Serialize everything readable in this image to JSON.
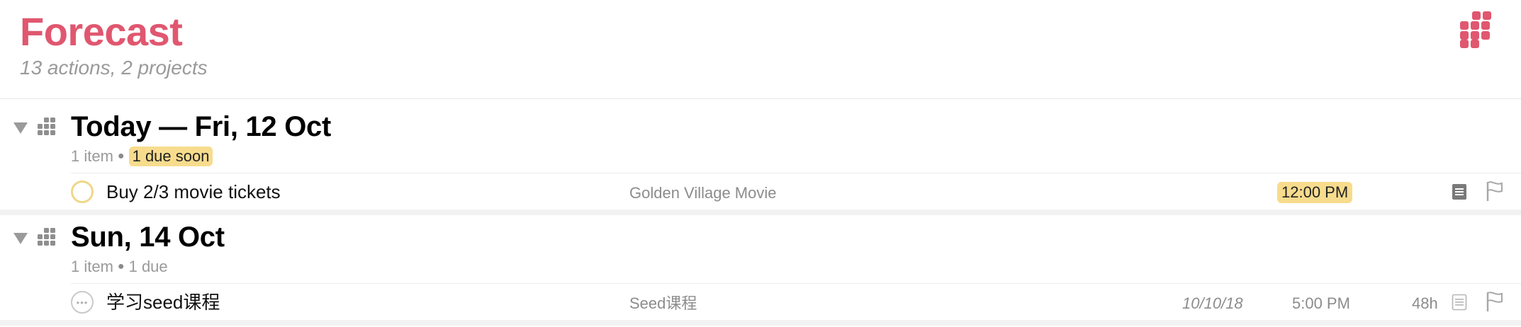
{
  "header": {
    "title": "Forecast",
    "subtitle": "13 actions, 2 projects",
    "accent_color": "#e0576f",
    "icon": "forecast-grid-icon"
  },
  "sections": [
    {
      "title": "Today — Fri, 12 Oct",
      "meta_count": "1 item",
      "meta_status": "1 due soon",
      "tasks": [
        {
          "title": "Buy 2/3 movie tickets",
          "project": "Golden Village Movie",
          "defer_date": "",
          "due_time": "12:00 PM",
          "duration": "",
          "status": "due-soon"
        }
      ]
    },
    {
      "title": "Sun, 14 Oct",
      "meta_count": "1 item",
      "meta_status": "1 due",
      "tasks": [
        {
          "title": "学习seed课程",
          "project": "Seed课程",
          "defer_date": "10/10/18",
          "due_time": "5:00 PM",
          "duration": "48h",
          "status": "deferred"
        }
      ]
    }
  ],
  "colors": {
    "due_soon_badge": "#f7dc8d",
    "secondary_text": "#9a9a9a"
  }
}
